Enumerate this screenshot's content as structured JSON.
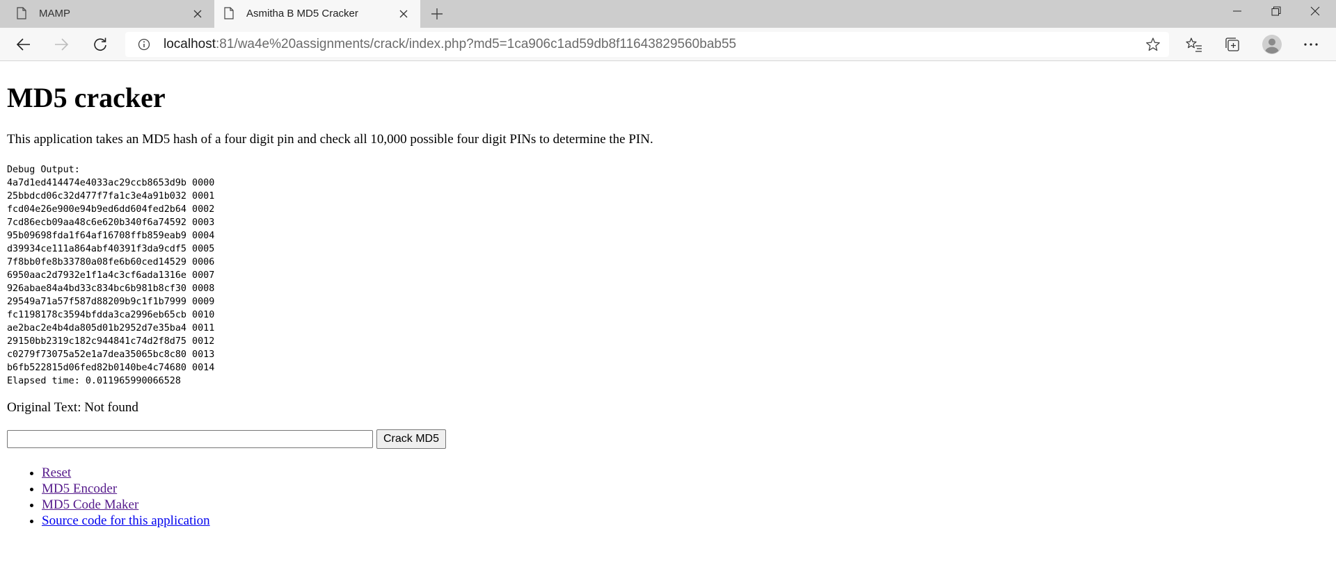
{
  "browser": {
    "tabs": [
      {
        "title": "MAMP",
        "active": false
      },
      {
        "title": "Asmitha B MD5 Cracker",
        "active": true
      }
    ],
    "url_host": "localhost",
    "url_rest": ":81/wa4e%20assignments/crack/index.php?md5=1ca906c1ad59db8f11643829560bab55"
  },
  "page": {
    "title": "MD5 cracker",
    "intro": "This application takes an MD5 hash of a four digit pin and check all 10,000 possible four digit PINs to determine the PIN.",
    "debug_header": "Debug Output:",
    "debug_lines": [
      "4a7d1ed414474e4033ac29ccb8653d9b 0000",
      "25bbdcd06c32d477f7fa1c3e4a91b032 0001",
      "fcd04e26e900e94b9ed6dd604fed2b64 0002",
      "7cd86ecb09aa48c6e620b340f6a74592 0003",
      "95b09698fda1f64af16708ffb859eab9 0004",
      "d39934ce111a864abf40391f3da9cdf5 0005",
      "7f8bb0fe8b33780a08fe6b60ced14529 0006",
      "6950aac2d7932e1f1a4c3cf6ada1316e 0007",
      "926abae84a4bd33c834bc6b981b8cf30 0008",
      "29549a71a57f587d88209b9c1f1b7999 0009",
      "fc1198178c3594bfdda3ca2996eb65cb 0010",
      "ae2bac2e4b4da805d01b2952d7e35ba4 0011",
      "29150bb2319c182c944841c74d2f8d75 0012",
      "c0279f73075a52e1a7dea35065bc8c80 0013",
      "b6fb522815d06fed82b0140be4c74680 0014"
    ],
    "elapsed": "Elapsed time: 0.011965990066528",
    "original_text": "Original Text: Not found",
    "input_value": "",
    "crack_button": "Crack MD5",
    "links": [
      {
        "label": "Reset",
        "visited": true
      },
      {
        "label": "MD5 Encoder",
        "visited": true
      },
      {
        "label": "MD5 Code Maker",
        "visited": true
      },
      {
        "label": "Source code for this application",
        "visited": false
      }
    ]
  }
}
